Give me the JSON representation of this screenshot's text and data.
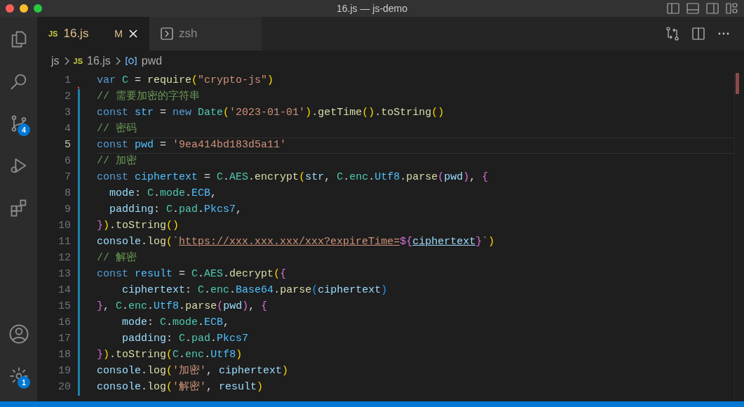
{
  "window": {
    "title": "16.js — js-demo"
  },
  "activity_bar": [
    {
      "kind": "files"
    },
    {
      "kind": "search"
    },
    {
      "kind": "source-control",
      "badge": "4"
    },
    {
      "kind": "debug"
    },
    {
      "kind": "extensions"
    }
  ],
  "activity_bar_bottom": [
    {
      "kind": "account"
    },
    {
      "kind": "settings",
      "badge": "1"
    }
  ],
  "tabs": [
    {
      "kind": "js",
      "icon_text": "JS",
      "label": "16.js",
      "status": "M",
      "selected": true
    },
    {
      "kind": "terminal",
      "label": "zsh",
      "selected": false
    }
  ],
  "breadcrumbs": [
    {
      "kind": "folder",
      "label": "js"
    },
    {
      "kind": "js",
      "icon_text": "JS",
      "label": "16.js"
    },
    {
      "kind": "symbol",
      "label": "pwd"
    }
  ],
  "code": [
    {
      "number": "1",
      "current": false,
      "changed": false,
      "deleted": true,
      "tokens": [
        {
          "kind": "kw",
          "text": "var "
        },
        {
          "kind": "cls",
          "text": "C"
        },
        {
          "kind": "pl",
          "text": " = "
        },
        {
          "kind": "fn",
          "text": "require"
        },
        {
          "kind": "b1",
          "text": "("
        },
        {
          "kind": "str",
          "text": "\"crypto-js\""
        },
        {
          "kind": "b1",
          "text": ")"
        }
      ]
    },
    {
      "number": "2",
      "current": false,
      "changed": true,
      "tokens": [
        {
          "kind": "cm",
          "text": "// 需要加密的字符串"
        }
      ]
    },
    {
      "number": "3",
      "current": false,
      "changed": true,
      "tokens": [
        {
          "kind": "kw",
          "text": "const "
        },
        {
          "kind": "cst",
          "text": "str"
        },
        {
          "kind": "pl",
          "text": " = "
        },
        {
          "kind": "kw",
          "text": "new "
        },
        {
          "kind": "cls",
          "text": "Date"
        },
        {
          "kind": "b1",
          "text": "("
        },
        {
          "kind": "str",
          "text": "'2023-01-01'"
        },
        {
          "kind": "b1",
          "text": ")"
        },
        {
          "kind": "pl",
          "text": "."
        },
        {
          "kind": "fn",
          "text": "getTime"
        },
        {
          "kind": "b1",
          "text": "()"
        },
        {
          "kind": "pl",
          "text": "."
        },
        {
          "kind": "fn",
          "text": "toString"
        },
        {
          "kind": "b1",
          "text": "()"
        }
      ]
    },
    {
      "number": "4",
      "current": false,
      "changed": true,
      "tokens": [
        {
          "kind": "cm",
          "text": "// 密码"
        }
      ]
    },
    {
      "number": "5",
      "current": true,
      "changed": true,
      "tokens": [
        {
          "kind": "kw",
          "text": "const "
        },
        {
          "kind": "cst",
          "text": "pwd"
        },
        {
          "kind": "pl",
          "text": " = "
        },
        {
          "kind": "str",
          "text": "'9ea414bd183d5a11'"
        }
      ]
    },
    {
      "number": "6",
      "current": false,
      "changed": true,
      "tokens": [
        {
          "kind": "cm",
          "text": "// 加密"
        }
      ]
    },
    {
      "number": "7",
      "current": false,
      "changed": true,
      "tokens": [
        {
          "kind": "kw",
          "text": "const "
        },
        {
          "kind": "cst",
          "text": "ciphertext"
        },
        {
          "kind": "pl",
          "text": " = "
        },
        {
          "kind": "cls",
          "text": "C"
        },
        {
          "kind": "pl",
          "text": "."
        },
        {
          "kind": "cls",
          "text": "AES"
        },
        {
          "kind": "pl",
          "text": "."
        },
        {
          "kind": "fn",
          "text": "encrypt"
        },
        {
          "kind": "b1",
          "text": "("
        },
        {
          "kind": "var",
          "text": "str"
        },
        {
          "kind": "pl",
          "text": ", "
        },
        {
          "kind": "cls",
          "text": "C"
        },
        {
          "kind": "pl",
          "text": "."
        },
        {
          "kind": "cls",
          "text": "enc"
        },
        {
          "kind": "pl",
          "text": "."
        },
        {
          "kind": "cst",
          "text": "Utf8"
        },
        {
          "kind": "pl",
          "text": "."
        },
        {
          "kind": "fn",
          "text": "parse"
        },
        {
          "kind": "b2",
          "text": "("
        },
        {
          "kind": "var",
          "text": "pwd"
        },
        {
          "kind": "b2",
          "text": ")"
        },
        {
          "kind": "pl",
          "text": ", "
        },
        {
          "kind": "b2",
          "text": "{"
        }
      ]
    },
    {
      "number": "8",
      "current": false,
      "changed": true,
      "tokens": [
        {
          "kind": "var",
          "text": "  mode"
        },
        {
          "kind": "pl",
          "text": ": "
        },
        {
          "kind": "cls",
          "text": "C"
        },
        {
          "kind": "pl",
          "text": "."
        },
        {
          "kind": "cls",
          "text": "mode"
        },
        {
          "kind": "pl",
          "text": "."
        },
        {
          "kind": "cst",
          "text": "ECB"
        },
        {
          "kind": "pl",
          "text": ","
        }
      ]
    },
    {
      "number": "9",
      "current": false,
      "changed": true,
      "tokens": [
        {
          "kind": "var",
          "text": "  padding"
        },
        {
          "kind": "pl",
          "text": ": "
        },
        {
          "kind": "cls",
          "text": "C"
        },
        {
          "kind": "pl",
          "text": "."
        },
        {
          "kind": "cls",
          "text": "pad"
        },
        {
          "kind": "pl",
          "text": "."
        },
        {
          "kind": "cst",
          "text": "Pkcs7"
        },
        {
          "kind": "pl",
          "text": ","
        }
      ]
    },
    {
      "number": "10",
      "current": false,
      "changed": true,
      "tokens": [
        {
          "kind": "b2",
          "text": "}"
        },
        {
          "kind": "b1",
          "text": ")"
        },
        {
          "kind": "pl",
          "text": "."
        },
        {
          "kind": "fn",
          "text": "toString"
        },
        {
          "kind": "b1",
          "text": "()"
        }
      ]
    },
    {
      "number": "11",
      "current": false,
      "changed": true,
      "tokens": [
        {
          "kind": "var",
          "text": "console"
        },
        {
          "kind": "pl",
          "text": "."
        },
        {
          "kind": "fn",
          "text": "log"
        },
        {
          "kind": "b1",
          "text": "("
        },
        {
          "kind": "str",
          "text": "`"
        },
        {
          "kind": "link",
          "text": "https://xxx.xxx.xxx/xxx?expireTime="
        },
        {
          "kind": "b2",
          "text": "${"
        },
        {
          "kind": "linkvar",
          "text": "ciphertext"
        },
        {
          "kind": "b2",
          "text": "}"
        },
        {
          "kind": "str",
          "text": "`"
        },
        {
          "kind": "b1",
          "text": ")"
        }
      ]
    },
    {
      "number": "12",
      "current": false,
      "changed": true,
      "tokens": [
        {
          "kind": "cm",
          "text": "// 解密"
        }
      ]
    },
    {
      "number": "13",
      "current": false,
      "changed": true,
      "tokens": [
        {
          "kind": "kw",
          "text": "const "
        },
        {
          "kind": "cst",
          "text": "result"
        },
        {
          "kind": "pl",
          "text": " = "
        },
        {
          "kind": "cls",
          "text": "C"
        },
        {
          "kind": "pl",
          "text": "."
        },
        {
          "kind": "cls",
          "text": "AES"
        },
        {
          "kind": "pl",
          "text": "."
        },
        {
          "kind": "fn",
          "text": "decrypt"
        },
        {
          "kind": "b1",
          "text": "("
        },
        {
          "kind": "b2",
          "text": "{"
        }
      ]
    },
    {
      "number": "14",
      "current": false,
      "changed": true,
      "tokens": [
        {
          "kind": "var",
          "text": "    ciphertext"
        },
        {
          "kind": "pl",
          "text": ": "
        },
        {
          "kind": "cls",
          "text": "C"
        },
        {
          "kind": "pl",
          "text": "."
        },
        {
          "kind": "cls",
          "text": "enc"
        },
        {
          "kind": "pl",
          "text": "."
        },
        {
          "kind": "cst",
          "text": "Base64"
        },
        {
          "kind": "pl",
          "text": "."
        },
        {
          "kind": "fn",
          "text": "parse"
        },
        {
          "kind": "b3",
          "text": "("
        },
        {
          "kind": "var",
          "text": "ciphertext"
        },
        {
          "kind": "b3",
          "text": ")"
        }
      ]
    },
    {
      "number": "15",
      "current": false,
      "changed": true,
      "tokens": [
        {
          "kind": "b2",
          "text": "}"
        },
        {
          "kind": "pl",
          "text": ", "
        },
        {
          "kind": "cls",
          "text": "C"
        },
        {
          "kind": "pl",
          "text": "."
        },
        {
          "kind": "cls",
          "text": "enc"
        },
        {
          "kind": "pl",
          "text": "."
        },
        {
          "kind": "cst",
          "text": "Utf8"
        },
        {
          "kind": "pl",
          "text": "."
        },
        {
          "kind": "fn",
          "text": "parse"
        },
        {
          "kind": "b2",
          "text": "("
        },
        {
          "kind": "var",
          "text": "pwd"
        },
        {
          "kind": "b2",
          "text": ")"
        },
        {
          "kind": "pl",
          "text": ", "
        },
        {
          "kind": "b2",
          "text": "{"
        }
      ]
    },
    {
      "number": "16",
      "current": false,
      "changed": true,
      "tokens": [
        {
          "kind": "var",
          "text": "    mode"
        },
        {
          "kind": "pl",
          "text": ": "
        },
        {
          "kind": "cls",
          "text": "C"
        },
        {
          "kind": "pl",
          "text": "."
        },
        {
          "kind": "cls",
          "text": "mode"
        },
        {
          "kind": "pl",
          "text": "."
        },
        {
          "kind": "cst",
          "text": "ECB"
        },
        {
          "kind": "pl",
          "text": ","
        }
      ]
    },
    {
      "number": "17",
      "current": false,
      "changed": true,
      "tokens": [
        {
          "kind": "var",
          "text": "    padding"
        },
        {
          "kind": "pl",
          "text": ": "
        },
        {
          "kind": "cls",
          "text": "C"
        },
        {
          "kind": "pl",
          "text": "."
        },
        {
          "kind": "cls",
          "text": "pad"
        },
        {
          "kind": "pl",
          "text": "."
        },
        {
          "kind": "cst",
          "text": "Pkcs7"
        }
      ]
    },
    {
      "number": "18",
      "current": false,
      "changed": true,
      "tokens": [
        {
          "kind": "b2",
          "text": "}"
        },
        {
          "kind": "b1",
          "text": ")"
        },
        {
          "kind": "pl",
          "text": "."
        },
        {
          "kind": "fn",
          "text": "toString"
        },
        {
          "kind": "b1",
          "text": "("
        },
        {
          "kind": "cls",
          "text": "C"
        },
        {
          "kind": "pl",
          "text": "."
        },
        {
          "kind": "cls",
          "text": "enc"
        },
        {
          "kind": "pl",
          "text": "."
        },
        {
          "kind": "cst",
          "text": "Utf8"
        },
        {
          "kind": "b1",
          "text": ")"
        }
      ]
    },
    {
      "number": "19",
      "current": false,
      "changed": true,
      "tokens": [
        {
          "kind": "var",
          "text": "console"
        },
        {
          "kind": "pl",
          "text": "."
        },
        {
          "kind": "fn",
          "text": "log"
        },
        {
          "kind": "b1",
          "text": "("
        },
        {
          "kind": "str",
          "text": "'加密'"
        },
        {
          "kind": "pl",
          "text": ", "
        },
        {
          "kind": "var",
          "text": "ciphertext"
        },
        {
          "kind": "b1",
          "text": ")"
        }
      ]
    },
    {
      "number": "20",
      "current": false,
      "changed": true,
      "tokens": [
        {
          "kind": "var",
          "text": "console"
        },
        {
          "kind": "pl",
          "text": "."
        },
        {
          "kind": "fn",
          "text": "log"
        },
        {
          "kind": "b1",
          "text": "("
        },
        {
          "kind": "str",
          "text": "'解密'"
        },
        {
          "kind": "pl",
          "text": ", "
        },
        {
          "kind": "var",
          "text": "result"
        },
        {
          "kind": "b1",
          "text": ")"
        }
      ]
    }
  ]
}
